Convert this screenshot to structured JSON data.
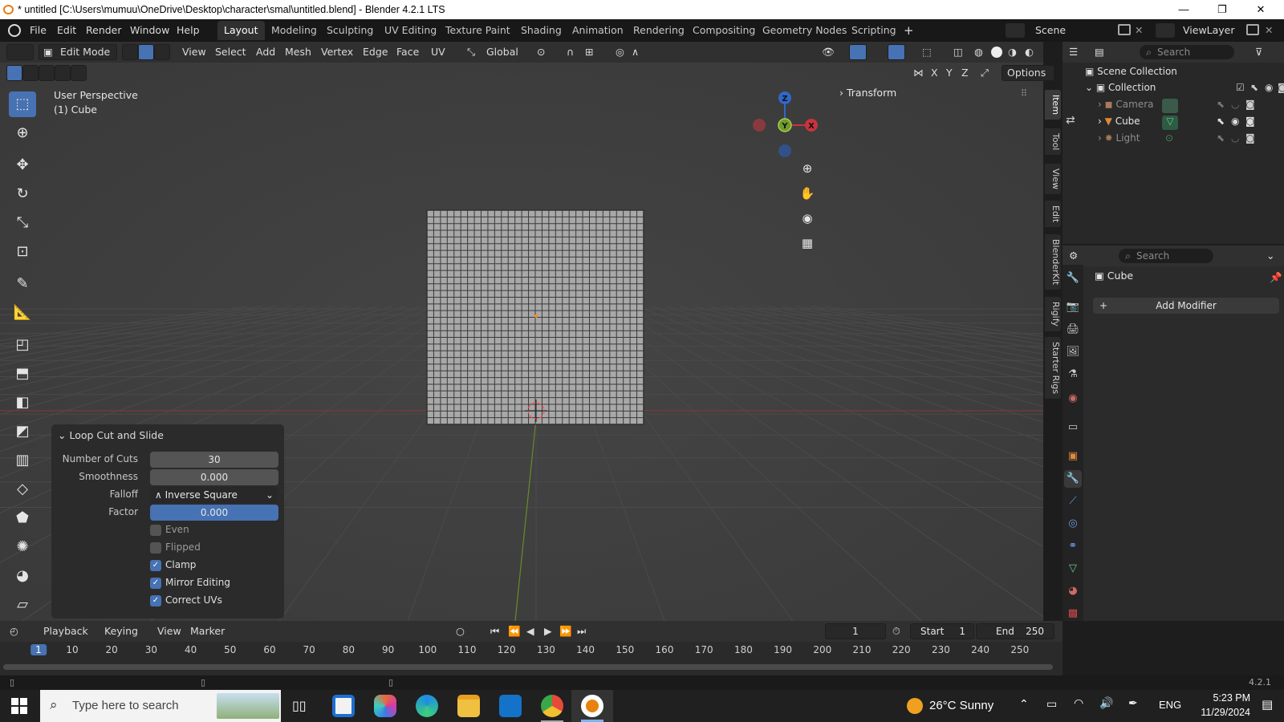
{
  "window": {
    "title": "* untitled [C:\\Users\\mumuu\\OneDrive\\Desktop\\character\\smal\\untitled.blend] - Blender 4.2.1 LTS",
    "minimize": "—",
    "maximize": "❐",
    "close": "✕"
  },
  "menu": {
    "items": [
      "File",
      "Edit",
      "Render",
      "Window",
      "Help"
    ],
    "workspaces": [
      "Layout",
      "Modeling",
      "Sculpting",
      "UV Editing",
      "Texture Paint",
      "Shading",
      "Animation",
      "Rendering",
      "Compositing",
      "Geometry Nodes",
      "Scripting"
    ],
    "active_workspace": "Layout",
    "add_tab": "+",
    "scene": "Scene",
    "view_layer": "ViewLayer"
  },
  "viewport_header": {
    "mode": "Edit Mode",
    "menus": [
      "View",
      "Select",
      "Add",
      "Mesh",
      "Vertex",
      "Edge",
      "Face",
      "UV"
    ],
    "orientation": "Global",
    "axis_x": "X",
    "axis_y": "Y",
    "axis_z": "Z",
    "options": "Options"
  },
  "viewport": {
    "perspective": "User Perspective",
    "object": "(1) Cube",
    "transform_label": "Transform",
    "gizmo_x": "X",
    "gizmo_y": "Y",
    "gizmo_z": "Z"
  },
  "side_tabs": [
    "Item",
    "Tool",
    "View",
    "Edit",
    "BlenderKit",
    "Rigify",
    "Starter Rigs"
  ],
  "operator_panel": {
    "title": "Loop Cut and Slide",
    "number_of_cuts_label": "Number of Cuts",
    "number_of_cuts": "30",
    "smoothness_label": "Smoothness",
    "smoothness": "0.000",
    "falloff_label": "Falloff",
    "falloff": "Inverse Square",
    "factor_label": "Factor",
    "factor": "0.000",
    "checkboxes": [
      {
        "label": "Even",
        "checked": false
      },
      {
        "label": "Flipped",
        "checked": false
      },
      {
        "label": "Clamp",
        "checked": true
      },
      {
        "label": "Mirror Editing",
        "checked": true
      },
      {
        "label": "Correct UVs",
        "checked": true
      }
    ]
  },
  "outliner": {
    "search_placeholder": "Search",
    "scene_collection": "Scene Collection",
    "collection": "Collection",
    "items": [
      "Camera",
      "Cube",
      "Light"
    ]
  },
  "properties": {
    "search_placeholder": "Search",
    "object_name": "Cube",
    "add_modifier": "Add Modifier"
  },
  "timeline": {
    "menus": [
      "Playback",
      "Keying",
      "View",
      "Marker"
    ],
    "current_frame": "1",
    "start_label": "Start",
    "start": "1",
    "end_label": "End",
    "end": "250",
    "ruler": [
      "1",
      "10",
      "20",
      "30",
      "40",
      "50",
      "60",
      "70",
      "80",
      "90",
      "100",
      "110",
      "120",
      "130",
      "140",
      "150",
      "160",
      "170",
      "180",
      "190",
      "200",
      "210",
      "220",
      "230",
      "240",
      "250"
    ]
  },
  "statusbar": {
    "version": "4.2.1"
  },
  "taskbar": {
    "search_placeholder": "Type here to search",
    "weather": "26°C  Sunny",
    "language": "ENG",
    "time": "5:23 PM",
    "date": "11/29/2024"
  }
}
